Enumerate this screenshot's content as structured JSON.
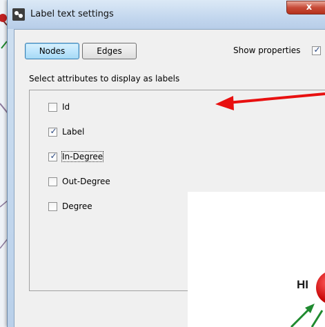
{
  "window": {
    "title": "Label text settings",
    "close_symbol": "x"
  },
  "toolbar": {
    "tabs": [
      {
        "label": "Nodes",
        "selected": true
      },
      {
        "label": "Edges",
        "selected": false
      }
    ],
    "show_properties_label": "Show properties",
    "show_properties_checked": true
  },
  "instructions": "Select attributes to display as labels",
  "attributes": [
    {
      "label": "Id",
      "checked": false
    },
    {
      "label": "Label",
      "checked": true
    },
    {
      "label": "In-Degree",
      "checked": true,
      "focused": true
    },
    {
      "label": "Out-Degree",
      "checked": false
    },
    {
      "label": "Degree",
      "checked": false
    }
  ],
  "overlay": {
    "node_label": "HI"
  },
  "colors": {
    "arrow": "#e81010",
    "selected_tab": "#bee6fd",
    "node_fill": "#c40000",
    "edge_green": "#1f8a2f"
  },
  "icons": {
    "app_icon": "gephi-app-icon",
    "check": "check-icon",
    "close": "close-icon"
  }
}
